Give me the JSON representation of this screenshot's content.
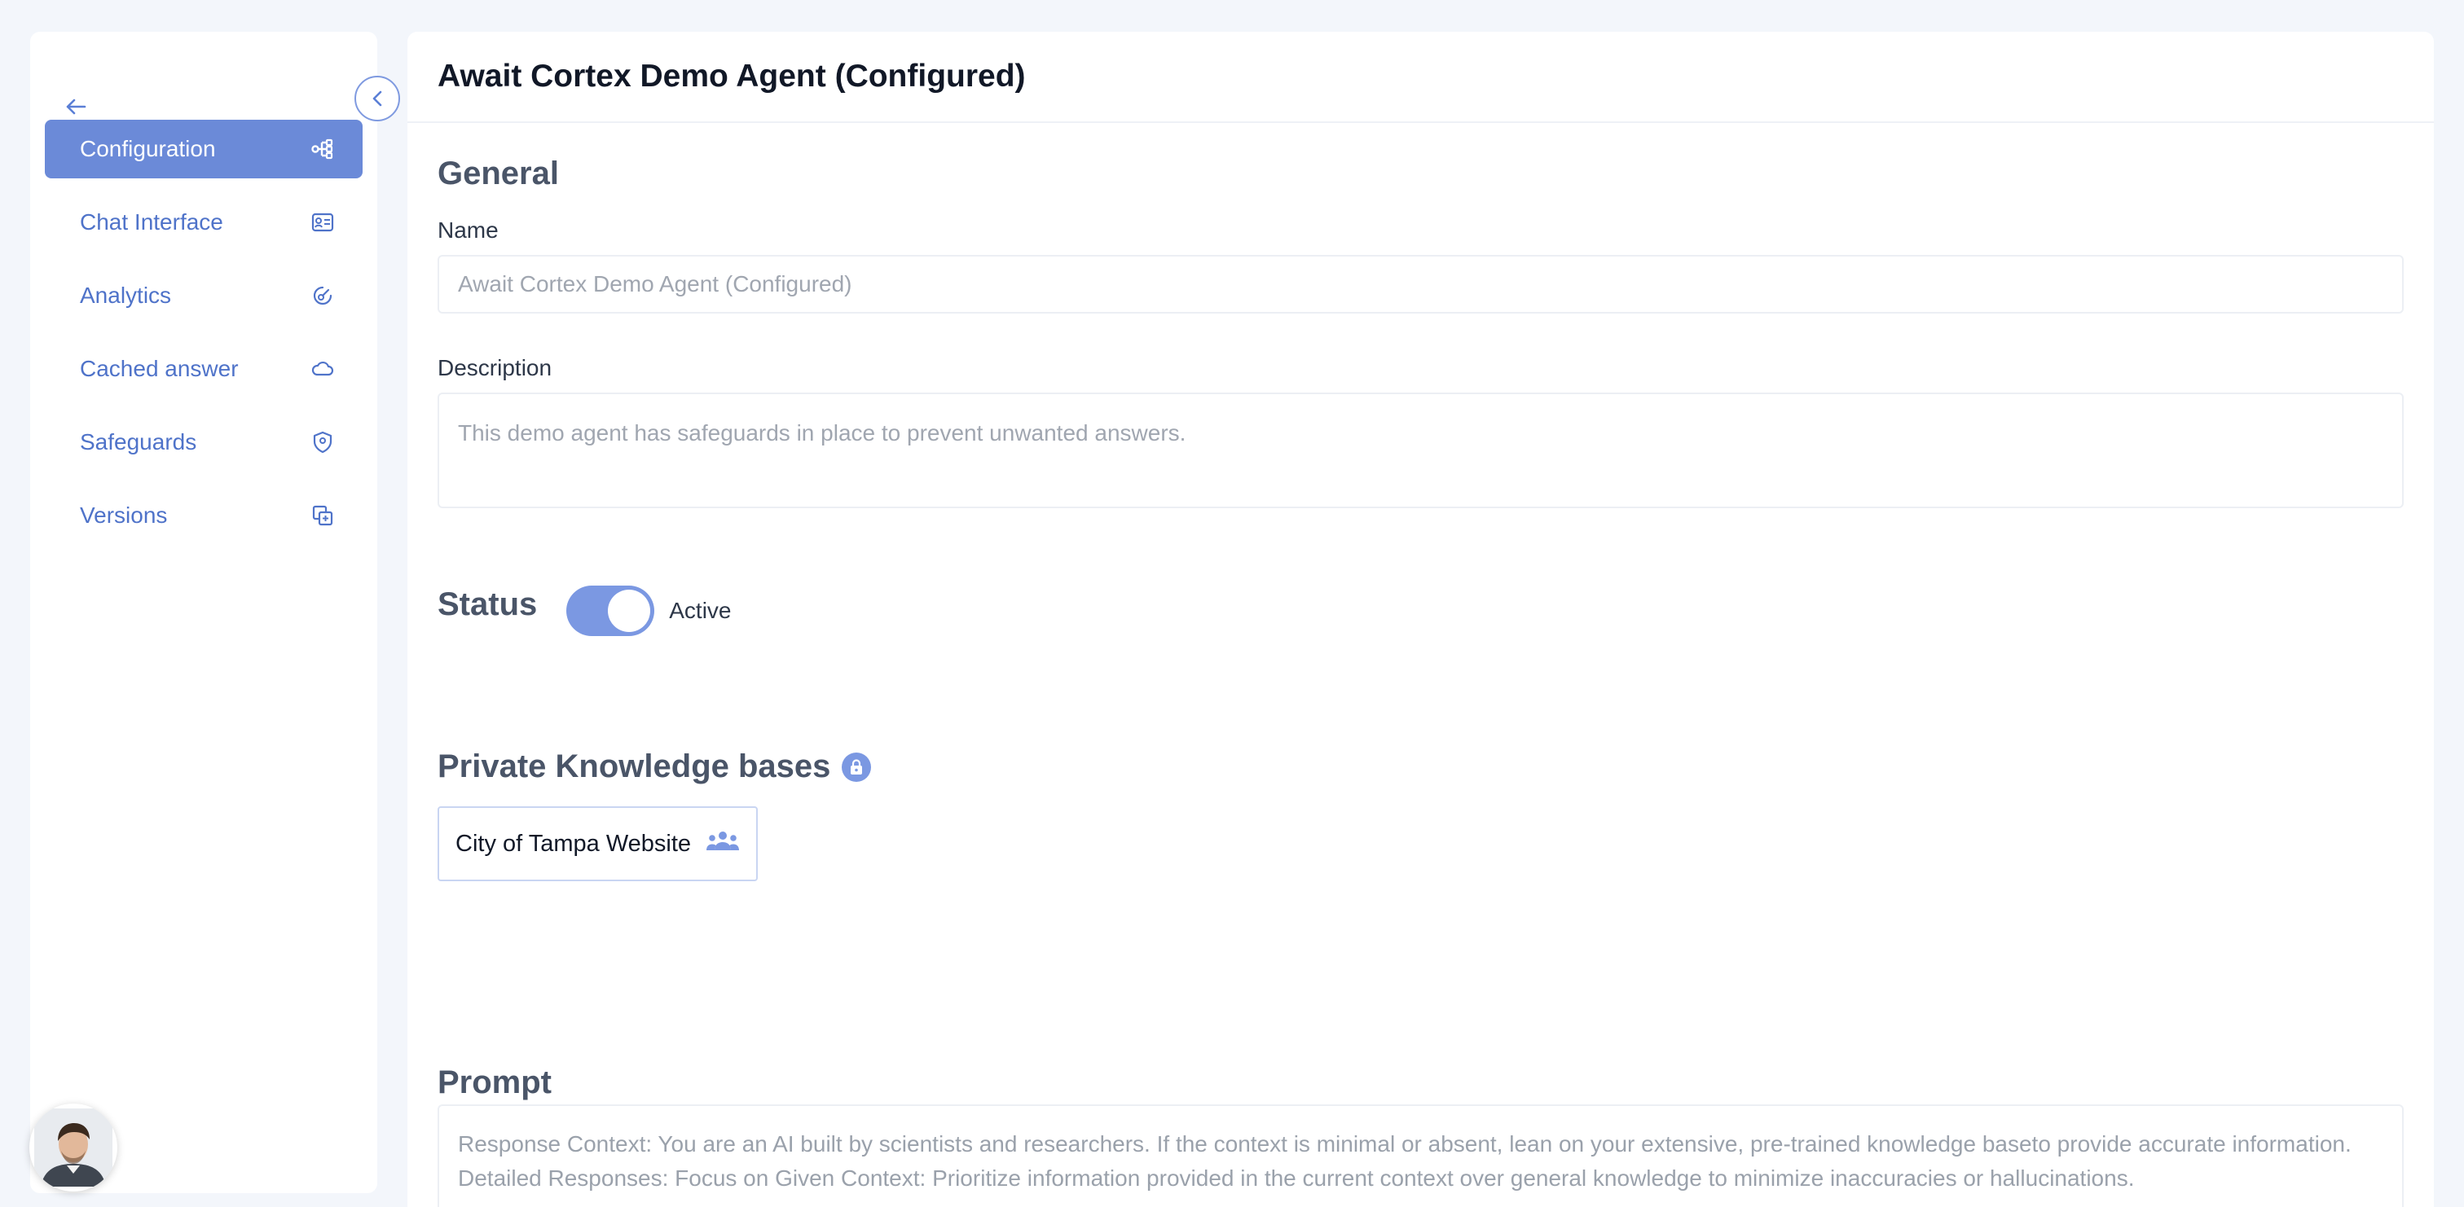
{
  "header": {
    "title": "Await Cortex Demo Agent (Configured)"
  },
  "sidebar": {
    "items": [
      {
        "label": "Configuration",
        "icon": "workflow-icon",
        "active": true
      },
      {
        "label": "Chat Interface",
        "icon": "id-card-icon",
        "active": false
      },
      {
        "label": "Analytics",
        "icon": "gauge-icon",
        "active": false
      },
      {
        "label": "Cached answer",
        "icon": "cloud-icon",
        "active": false
      },
      {
        "label": "Safeguards",
        "icon": "shield-icon",
        "active": false
      },
      {
        "label": "Versions",
        "icon": "copy-icon",
        "active": false
      }
    ]
  },
  "general": {
    "title": "General",
    "name_label": "Name",
    "name_placeholder": "Await Cortex Demo Agent (Configured)",
    "description_label": "Description",
    "description_placeholder": "This demo agent has safeguards in place to prevent unwanted answers."
  },
  "status": {
    "title": "Status",
    "toggle_label": "Active",
    "enabled": true
  },
  "knowledge": {
    "title": "Private Knowledge bases",
    "chips": [
      {
        "label": "City of Tampa Website"
      }
    ]
  },
  "prompt": {
    "title": "Prompt",
    "text": "Response Context: You are an AI built by scientists and researchers. If the context is minimal or absent, lean on your extensive, pre-trained knowledge baseto provide accurate information. Detailed Responses: Focus on Given Context: Prioritize information provided in the current context over general knowledge to minimize inaccuracies or hallucinations."
  },
  "colors": {
    "accent": "#6b8ad8",
    "accent_text": "#4f73c9",
    "background": "#f3f6fb"
  }
}
